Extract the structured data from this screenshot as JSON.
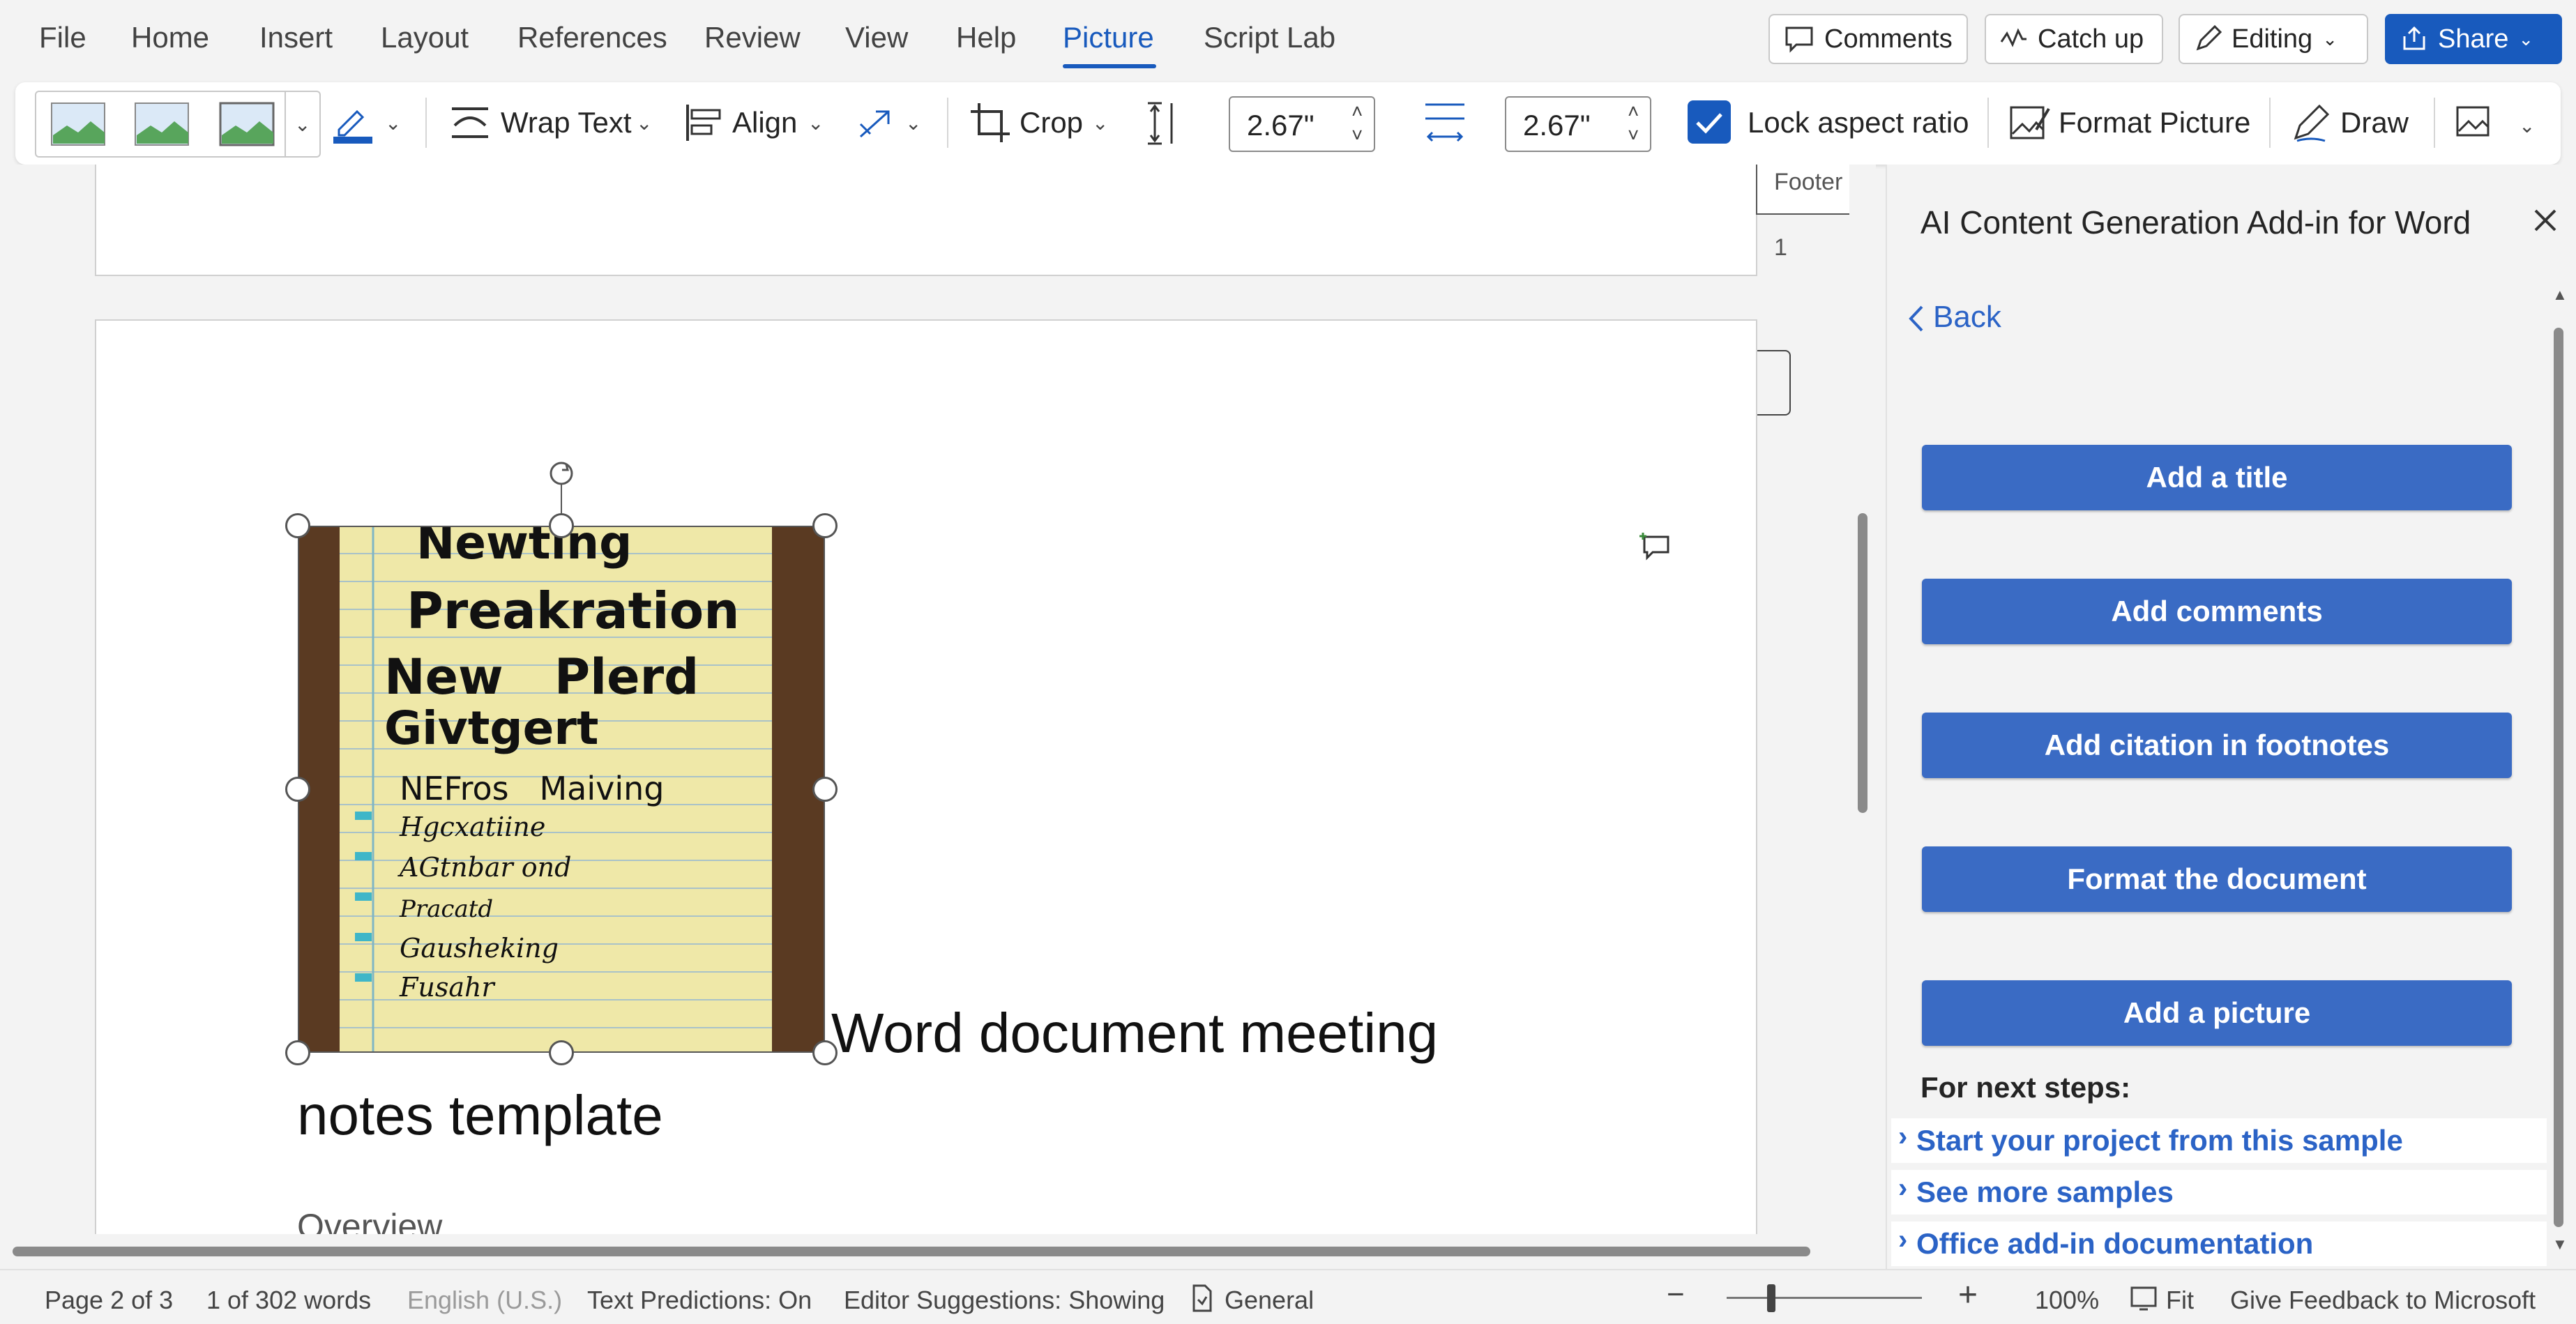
{
  "menu": {
    "items": [
      "File",
      "Home",
      "Insert",
      "Layout",
      "References",
      "Review",
      "View",
      "Help",
      "Picture",
      "Script Lab"
    ],
    "active": "Picture"
  },
  "top_buttons": {
    "comments": "Comments",
    "catch_up": "Catch up",
    "editing": "Editing",
    "share": "Share"
  },
  "ribbon": {
    "wrap_text": "Wrap Text",
    "align": "Align",
    "crop": "Crop",
    "height_value": "2.67\"",
    "width_value": "2.67\"",
    "lock_aspect_ratio": "Lock aspect ratio",
    "lock_checked": true,
    "format_picture": "Format Picture",
    "draw": "Draw"
  },
  "document": {
    "footer_tab": "Footer",
    "footer_page_number": "1",
    "heading_part1": "Word document meeting",
    "heading_part2": "notes template",
    "overview": "Overview",
    "image_lines": [
      "Newting",
      "Preakration",
      "New   Plerd",
      "Givtgert",
      "NEFros   Maiving",
      "Hgcxatiine",
      "AGtnbar ond",
      "Pracatd",
      "Gausheking",
      "Fusahr"
    ]
  },
  "pane": {
    "title": "AI Content Generation Add-in for Word",
    "back": "Back",
    "buttons": [
      "Add a title",
      "Add comments",
      "Add citation in footnotes",
      "Format the document",
      "Add a picture"
    ],
    "next_steps_label": "For next steps:",
    "links": [
      "Start your project from this sample",
      "See more samples",
      "Office add-in documentation"
    ]
  },
  "status": {
    "page": "Page 2 of 3",
    "words": "1 of 302 words",
    "language": "English (U.S.)",
    "text_predictions": "Text Predictions: On",
    "editor_suggestions": "Editor Suggestions: Showing",
    "sensitivity": "General",
    "zoom": "100%",
    "fit": "Fit",
    "feedback": "Give Feedback to Microsoft"
  },
  "colors": {
    "accent": "#185abd",
    "pane_button": "#3a6bc4",
    "link": "#2b63c6"
  }
}
